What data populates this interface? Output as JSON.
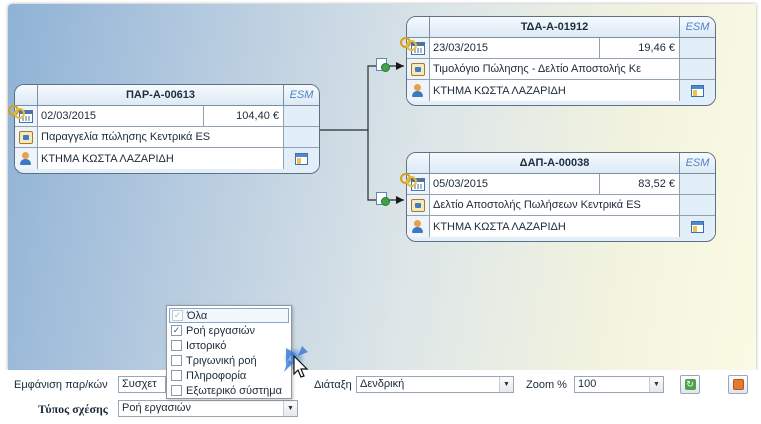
{
  "cards": {
    "source": {
      "title": "ΠΑΡ-Α-00613",
      "esm": "ESM",
      "date": "02/03/2015",
      "amount": "104,40 €",
      "doc_type": "Παραγγελία πώλησης Κεντρικά ES",
      "customer": "ΚΤΗΜΑ ΚΩΣΤΑ ΛΑΖΑΡΙΔΗ"
    },
    "invoice": {
      "title": "ΤΔΑ-Α-01912",
      "esm": "ESM",
      "date": "23/03/2015",
      "amount": "19,46 €",
      "doc_type": "Τιμολόγιο Πώλησης - Δελτίο Αποστολής Κε",
      "customer": "ΚΤΗΜΑ ΚΩΣΤΑ ΛΑΖΑΡΙΔΗ"
    },
    "delivery": {
      "title": "ΔΑΠ-Α-00038",
      "esm": "ESM",
      "date": "05/03/2015",
      "amount": "83,52 €",
      "doc_type": "Δελτίο Αποστολής Πωλήσεων Κεντρικά ES",
      "customer": "ΚΤΗΜΑ ΚΩΣΤΑ ΛΑΖΑΡΙΔΗ"
    }
  },
  "toolbar": {
    "show_label": "Εμφάνιση παρ/κών",
    "show_value": "Συσχετ",
    "layout_label": "Διάταξη",
    "layout_value": "Δενδρική",
    "zoom_label": "Zoom %",
    "zoom_value": "100",
    "relation_label": "Τύπος σχέσης",
    "relation_value": "Ροή εργασιών"
  },
  "dropdown": {
    "options": [
      {
        "label": "Όλα",
        "checked": true,
        "disabled": true
      },
      {
        "label": "Ροή εργασιών",
        "checked": true,
        "disabled": false
      },
      {
        "label": "Ιστορικό",
        "checked": false,
        "disabled": false
      },
      {
        "label": "Τριγωνική ροή",
        "checked": false,
        "disabled": false
      },
      {
        "label": "Πληροφορία",
        "checked": false,
        "disabled": false
      },
      {
        "label": "Εξωτερικό σύστημα",
        "checked": false,
        "disabled": false
      }
    ]
  },
  "icons": {
    "keys": "keys-icon",
    "calendar": "calendar-icon",
    "document": "document-icon",
    "customer": "customer-icon",
    "panel": "panel-icon",
    "refresh": "refresh-icon",
    "export": "export-icon"
  }
}
